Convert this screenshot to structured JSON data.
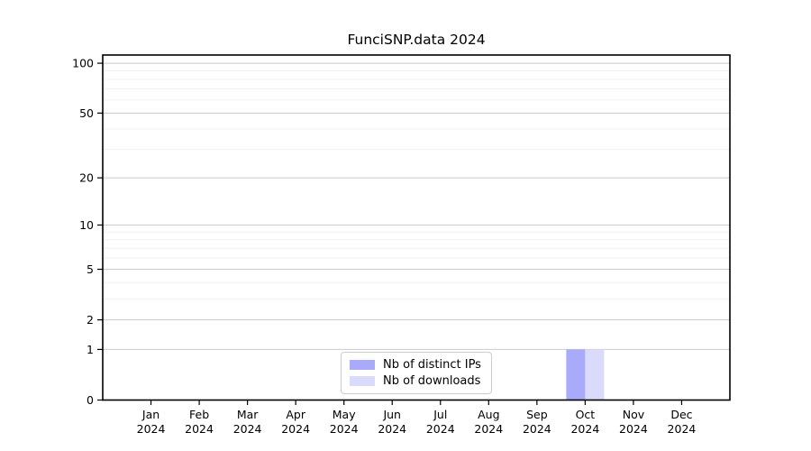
{
  "chart_data": {
    "type": "bar",
    "title": "FunciSNP.data 2024",
    "categories": [
      "Jan",
      "Feb",
      "Mar",
      "Apr",
      "May",
      "Jun",
      "Jul",
      "Aug",
      "Sep",
      "Oct",
      "Nov",
      "Dec"
    ],
    "category_year": "2024",
    "series": [
      {
        "name": "Nb of distinct IPs",
        "color": "#aaaafa",
        "values": [
          0,
          0,
          0,
          0,
          0,
          0,
          0,
          0,
          0,
          1,
          0,
          0
        ]
      },
      {
        "name": "Nb of downloads",
        "color": "#dadafa",
        "values": [
          0,
          0,
          0,
          0,
          0,
          0,
          0,
          0,
          0,
          1,
          0,
          0
        ]
      }
    ],
    "xlabel": "",
    "ylabel": "",
    "y_scale": "log1p",
    "ylim": [
      0,
      112
    ],
    "y_major_ticks": [
      0,
      1,
      2,
      5,
      10,
      20,
      50,
      100
    ],
    "y_minor_gridlines": [
      3,
      4,
      6,
      7,
      8,
      9,
      30,
      40,
      60,
      70,
      80,
      90
    ],
    "grid": true,
    "legend_position": "lower center inside",
    "colors": {
      "text": "#000000",
      "axis": "#000000",
      "grid_major": "#cccccc",
      "grid_minor": "#f0f0f0",
      "legend_border": "#cccccc",
      "background": "#ffffff"
    }
  }
}
